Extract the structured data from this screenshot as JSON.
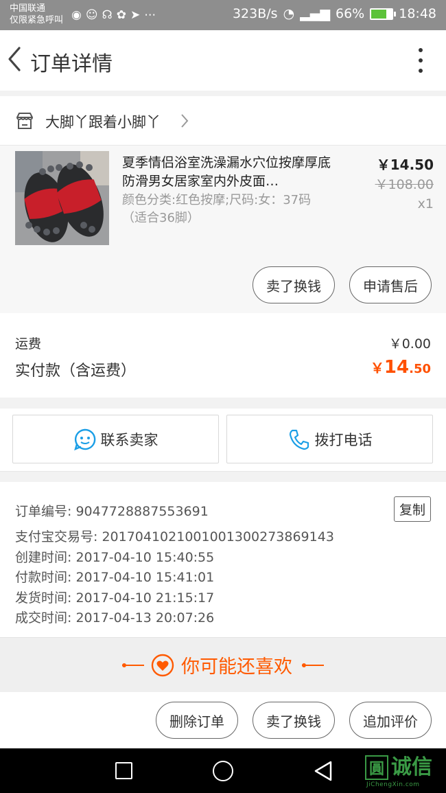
{
  "status_bar": {
    "carrier_line1": "中国联通",
    "carrier_line2": "仅限紧急呼叫",
    "net_speed": "323B/s",
    "battery": "66%",
    "time": "18:48"
  },
  "header": {
    "title": "订单详情"
  },
  "shop": {
    "name": "大脚丫跟着小脚丫"
  },
  "product": {
    "title": "夏季情侣浴室洗澡漏水穴位按摩厚底防滑男女居家室内外皮面…",
    "sku": "颜色分类:红色按摩;尺码:女：37码（适合36脚）",
    "price": "￥14.50",
    "original_price": "￥108.00",
    "quantity": "x1",
    "actions": {
      "sell": "卖了换钱",
      "after_sale": "申请售后"
    }
  },
  "totals": {
    "shipping_label": "运费",
    "shipping_value": "￥0.00",
    "paid_label": "实付款（含运费）",
    "paid_currency": "￥",
    "paid_int": "14",
    "paid_dec": ".50"
  },
  "contact": {
    "seller": "联系卖家",
    "phone": "拨打电话"
  },
  "order_info": {
    "order_no": "订单编号: 9047728887553691",
    "alipay_no": "支付宝交易号: 2017041021001001300273869143",
    "created": "创建时间: 2017-04-10 15:40:55",
    "paid": "付款时间: 2017-04-10 15:41:01",
    "shipped": "发货时间: 2017-04-10 21:15:17",
    "completed": "成交时间: 2017-04-13 20:07:26",
    "copy_label": "复制"
  },
  "recommend": {
    "title": "你可能还喜欢"
  },
  "bottom_actions": {
    "delete": "删除订单",
    "sell": "卖了换钱",
    "review": "追加评价"
  },
  "watermark": {
    "box": "圓",
    "text": "诚信",
    "sub": "JiChengXin.com"
  },
  "colors": {
    "accent": "#ff5000",
    "statusbar": "#8e8e8e",
    "link_blue": "#1a9ee6"
  }
}
